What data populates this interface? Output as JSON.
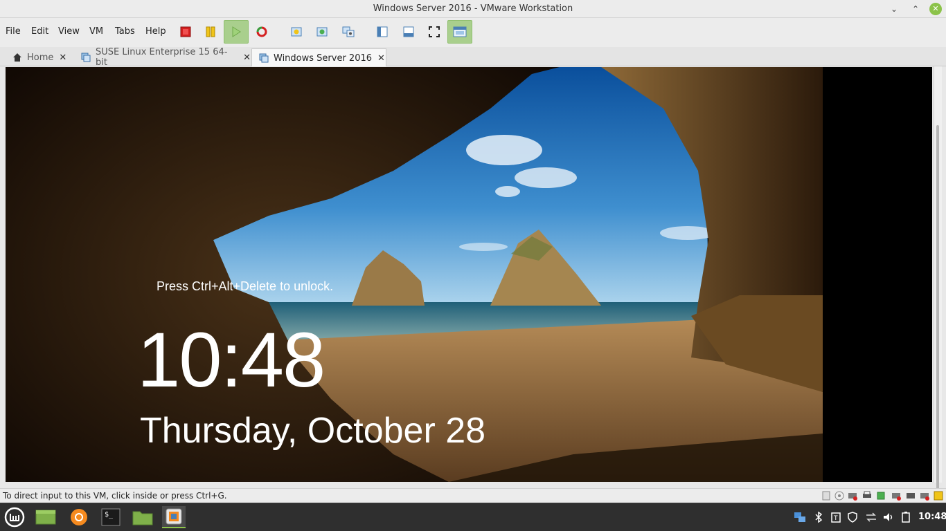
{
  "window": {
    "title": "Windows Server 2016 - VMware Workstation"
  },
  "menu": [
    "File",
    "Edit",
    "View",
    "VM",
    "Tabs",
    "Help"
  ],
  "toolbar": {
    "icons": [
      "power-off-icon",
      "suspend-icon",
      "power-on-icon",
      "reset-icon",
      "snapshot-icon",
      "revert-snapshot-icon",
      "snapshot-manager-icon",
      "show-library-icon",
      "thumbnail-bar-icon",
      "full-screen-icon",
      "unity-icon"
    ]
  },
  "tabs": [
    {
      "label": "Home",
      "close": "✕",
      "active": false
    },
    {
      "label": "SUSE Linux Enterprise 15 64-bit",
      "close": "✕",
      "active": false
    },
    {
      "label": "Windows Server 2016",
      "close": "✕",
      "active": true
    }
  ],
  "lockscreen": {
    "prompt": "Press Ctrl+Alt+Delete to unlock.",
    "time": "10:48",
    "date": "Thursday, October 28"
  },
  "status": {
    "text": "To direct input to this VM, click inside or press Ctrl+G."
  },
  "taskbar": {
    "apps": [
      "mint-menu-icon",
      "show-desktop-icon",
      "firefox-icon",
      "terminal-icon",
      "files-icon",
      "vmware-icon"
    ],
    "clock": "10:48"
  },
  "colors": {
    "accent": "#8cc34a",
    "taskbar": "#2f2f2f"
  }
}
